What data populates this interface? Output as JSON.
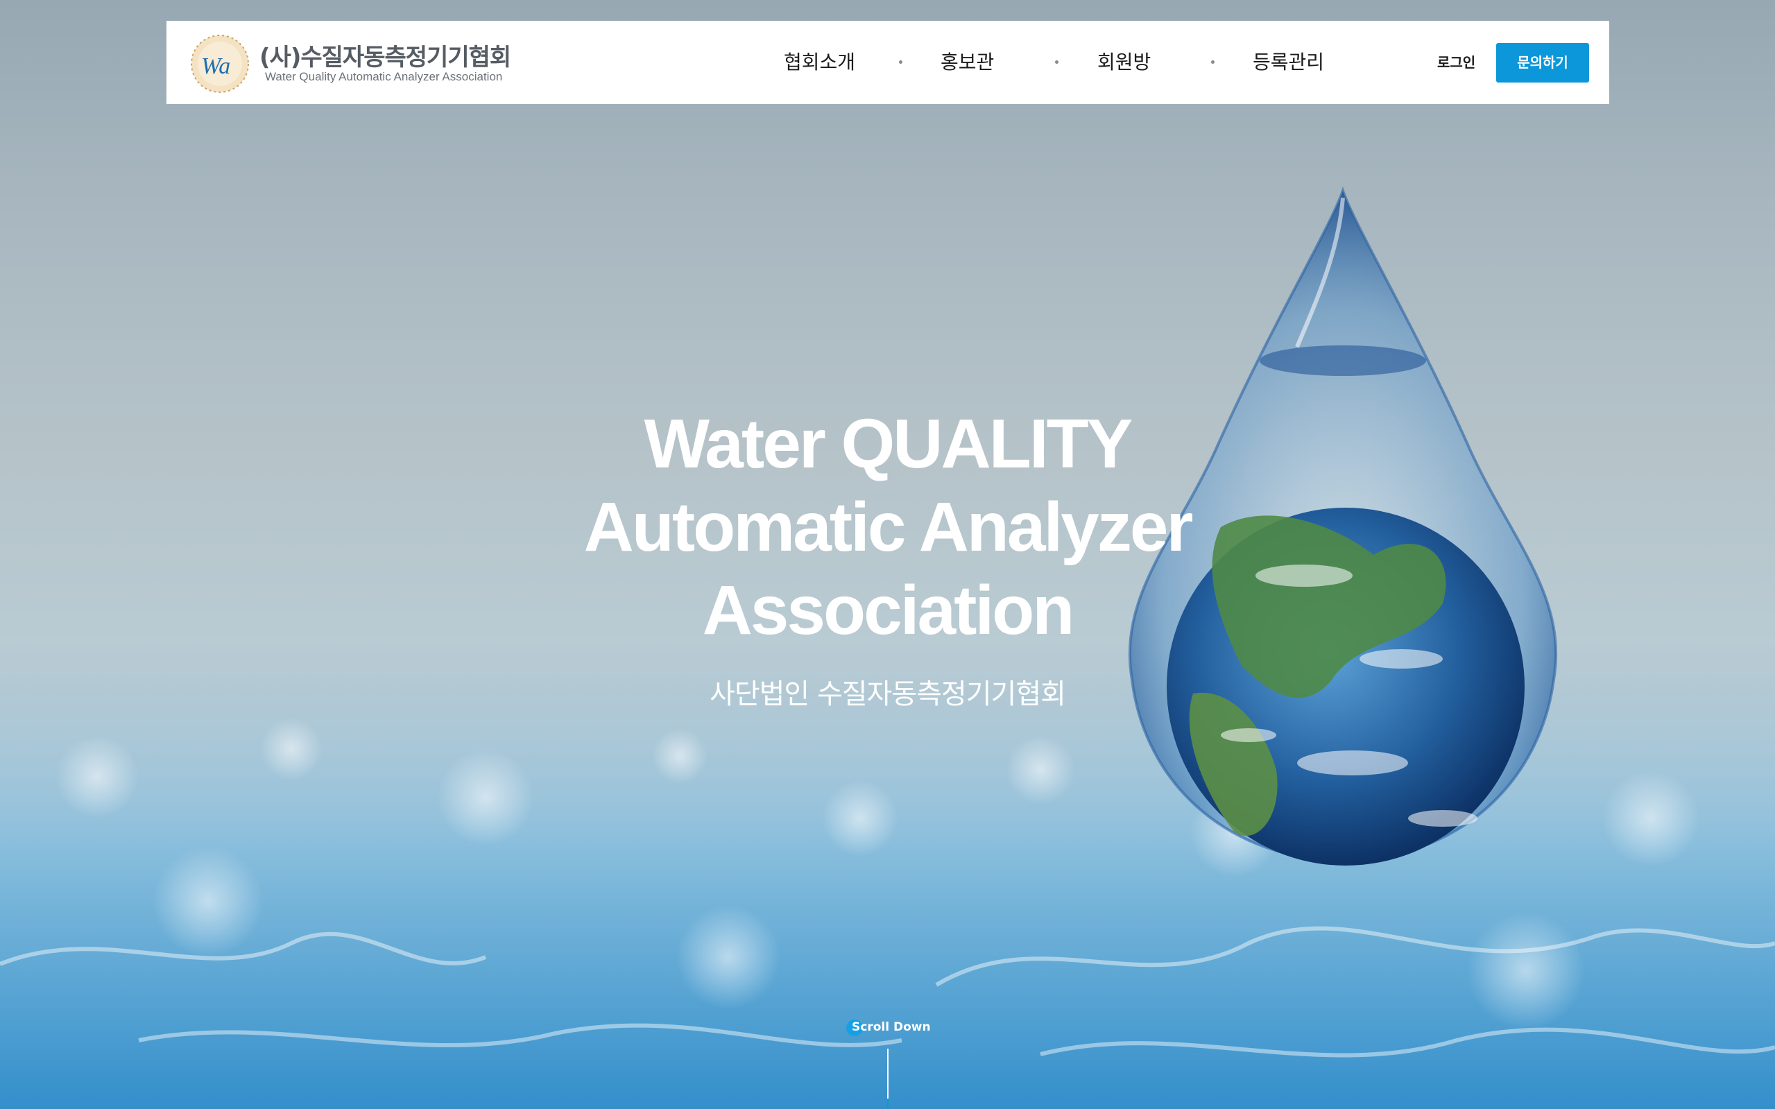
{
  "header": {
    "logo_emblem_text": "Wa",
    "logo_title": "(사)수질자동측정기기협회",
    "logo_subtitle": "Water Quality Automatic Analyzer Association"
  },
  "nav": {
    "items": [
      {
        "label": "협회소개"
      },
      {
        "label": "홍보관"
      },
      {
        "label": "회원방"
      },
      {
        "label": "등록관리"
      }
    ]
  },
  "actions": {
    "login_label": "로그인",
    "contact_label": "문의하기"
  },
  "hero": {
    "title_lines": [
      "Water QUALITY",
      "Automatic Analyzer",
      "Association"
    ],
    "subtitle": "사단법인 수질자동측정기기협회"
  },
  "scroll": {
    "label": "Scroll Down"
  },
  "colors": {
    "accent": "#0b97d9",
    "header_bg": "#ffffff",
    "text_dark": "#1b1b1b",
    "hero_text": "#ffffff"
  },
  "icons": {
    "logo": "wa-emblem-icon",
    "hero_image": "earth-in-water-drop-icon",
    "scroll": "scroll-dot-icon"
  }
}
